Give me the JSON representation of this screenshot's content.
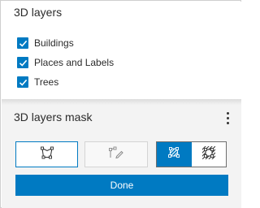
{
  "layers_panel": {
    "title": "3D layers",
    "items": [
      {
        "label": "Buildings",
        "checked": true
      },
      {
        "label": "Places and Labels",
        "checked": true
      },
      {
        "label": "Trees",
        "checked": true
      }
    ]
  },
  "mask_panel": {
    "title": "3D layers mask",
    "more_icon": "more-vertical-icon",
    "tools": {
      "polygon_icon": "polygon-draw-icon",
      "polyline_icon": "polyline-draw-icon",
      "selected_tool": "polygon"
    },
    "mask_mode": {
      "options": [
        "mask-inside-icon",
        "mask-outside-icon"
      ],
      "selected": "mask-inside-icon"
    },
    "done_label": "Done"
  },
  "colors": {
    "accent": "#007ac2",
    "panel_bg": "#f3f3f3",
    "text": "#323232"
  }
}
